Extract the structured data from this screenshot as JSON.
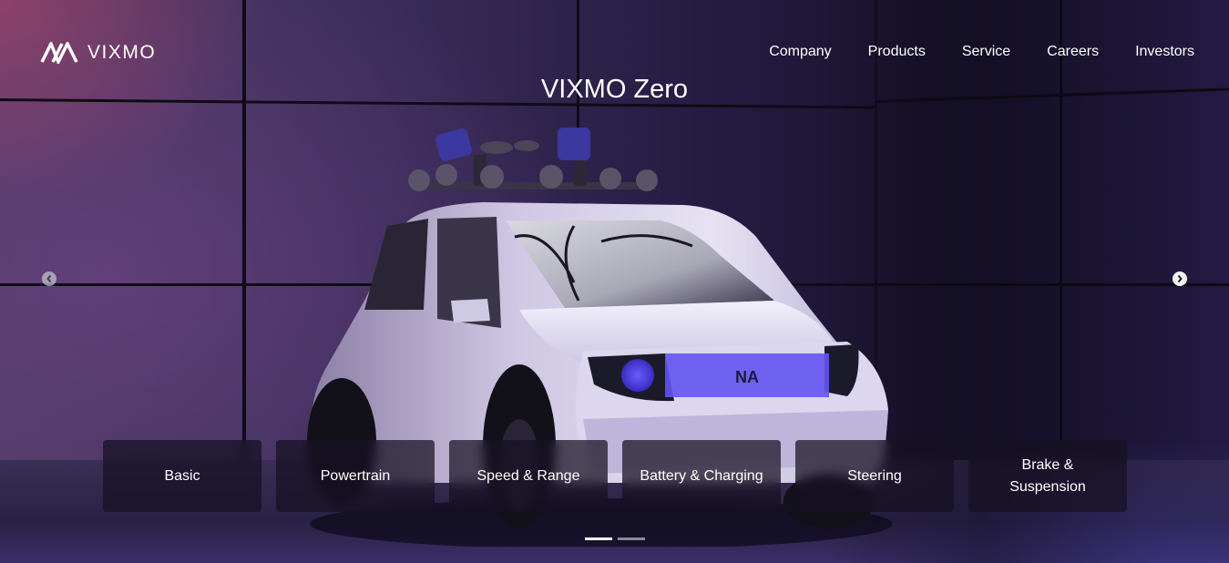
{
  "brand": {
    "name": "VIXMO",
    "logo_icon": "vixmo-logo-icon"
  },
  "nav": {
    "items": [
      {
        "label": "Company"
      },
      {
        "label": "Products"
      },
      {
        "label": "Service"
      },
      {
        "label": "Careers"
      },
      {
        "label": "Investors"
      }
    ]
  },
  "hero": {
    "title": "VIXMO Zero",
    "prev_icon": "chevron-left-icon",
    "next_icon": "chevron-right-icon"
  },
  "tabs": [
    {
      "label": "Basic"
    },
    {
      "label": "Powertrain"
    },
    {
      "label": "Speed & Range"
    },
    {
      "label": "Battery & Charging"
    },
    {
      "label": "Steering"
    },
    {
      "label": "Brake &\nSuspension"
    }
  ],
  "carousel": {
    "slide_count": 2,
    "active_index": 0
  },
  "colors": {
    "background": "#2a2048",
    "accent_blue": "#5a4cff",
    "tab_bg": "#161022"
  }
}
